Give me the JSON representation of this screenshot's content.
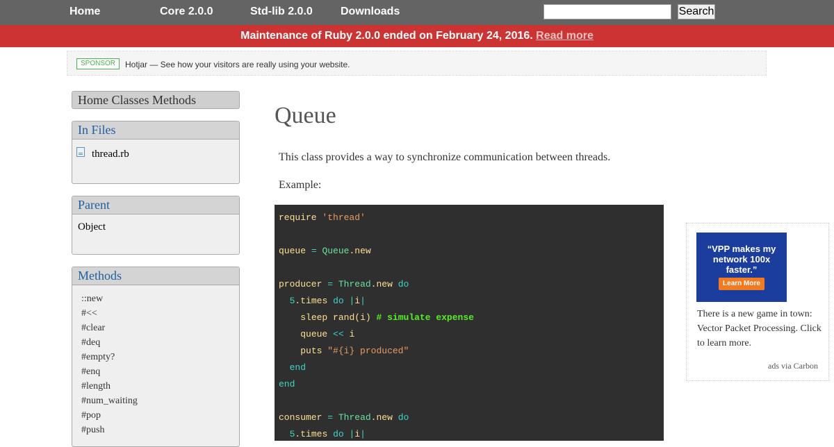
{
  "nav": {
    "home": "Home",
    "core": "Core 2.0.0",
    "stdlib": "Std-lib 2.0.0",
    "downloads": "Downloads"
  },
  "search": {
    "value": "",
    "button_label": "Search"
  },
  "banner": {
    "text": "Maintenance of Ruby 2.0.0 ended on February 24, 2016.",
    "link": "Read more"
  },
  "sponsor": {
    "badge": "SPONSOR",
    "text": "Hotjar — See how your visitors are really using your website."
  },
  "sidebar": {
    "nav_label": "Home Classes Methods",
    "in_files": {
      "title": "In Files",
      "file": "thread.rb"
    },
    "parent": {
      "title": "Parent",
      "value": "Object"
    },
    "methods": {
      "title": "Methods",
      "items": [
        "::new",
        "#<<",
        "#clear",
        "#deq",
        "#empty?",
        "#enq",
        "#length",
        "#num_waiting",
        "#pop",
        "#push"
      ]
    }
  },
  "main": {
    "title": "Queue",
    "description": "This class provides a way to synchronize communication between threads.",
    "example_label": "Example:"
  },
  "code": {
    "tokens": {
      "require": "require",
      "thread_str": "'thread'",
      "queue": "queue",
      "eq": "=",
      "queue_cls": "Queue",
      "dot": ".",
      "new": "new",
      "producer": "producer",
      "thread_cls": "Thread",
      "do": "do",
      "five": "5",
      "times": "times",
      "pipe_open": "|",
      "i": "i",
      "pipe_close": "|",
      "sleep": "sleep",
      "rand": "rand",
      "paren_open": "(",
      "paren_close": ")",
      "comment": "# simulate expense",
      "lshift": "<<",
      "puts": "puts",
      "produced_str": "\"#{i} produced\"",
      "end": "end",
      "consumer": "consumer"
    }
  },
  "ad": {
    "quote": "“VPP makes my network 100x faster.”",
    "button": "Learn More",
    "text": "There is a new game in town: Vector Packet Processing. Click to learn more.",
    "credit": "ads via Carbon"
  }
}
